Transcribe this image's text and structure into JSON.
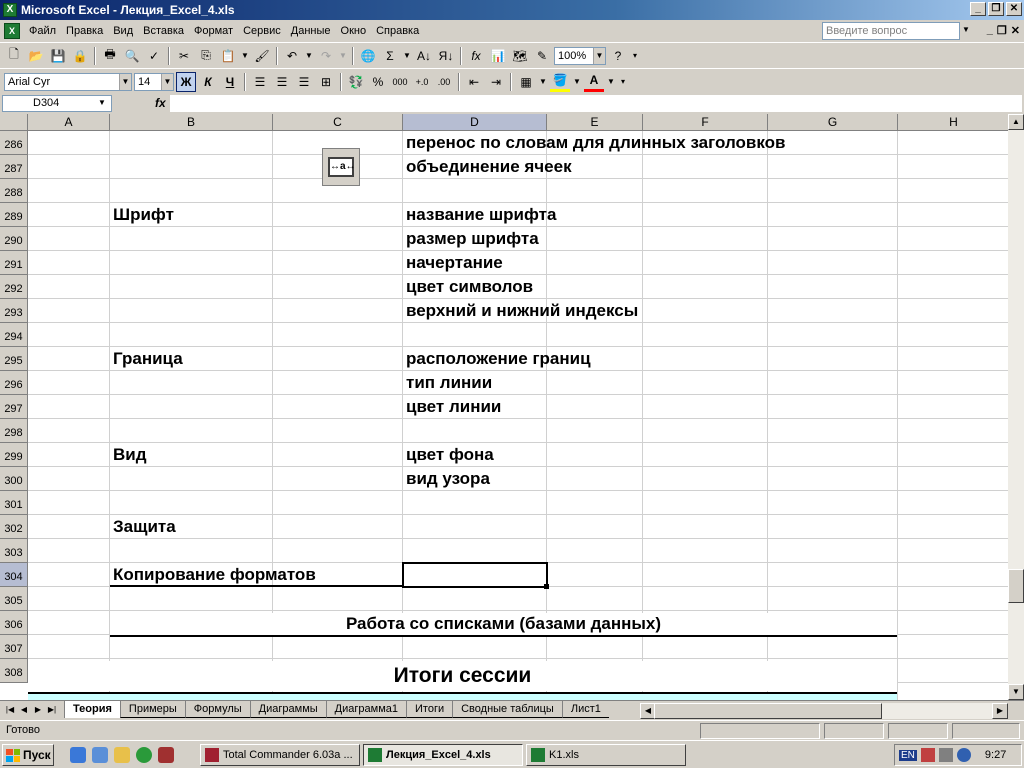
{
  "window": {
    "title": "Microsoft Excel - Лекция_Excel_4.xls",
    "controls": [
      "_",
      "❐",
      "✕"
    ]
  },
  "menu": {
    "items": [
      "Файл",
      "Правка",
      "Вид",
      "Вставка",
      "Формат",
      "Сервис",
      "Данные",
      "Окно",
      "Справка"
    ],
    "help_placeholder": "Введите вопрос"
  },
  "toolbar_standard": {
    "zoom": "100%",
    "icons": [
      "new-icon",
      "open-icon",
      "save-icon",
      "permission-icon",
      "print-icon",
      "print-preview-icon",
      "spelling-icon",
      "cut-icon",
      "copy-icon",
      "paste-icon",
      "format-painter-icon",
      "undo-icon",
      "redo-icon",
      "hyperlink-icon",
      "autosum-icon",
      "sort-asc-icon",
      "sort-desc-icon",
      "function-icon",
      "chart-wizard-icon",
      "drawing-icon",
      "help-icon"
    ]
  },
  "toolbar_format": {
    "font": "Arial Cyr",
    "size": "14",
    "bold": "Ж",
    "italic": "К",
    "underline": "Ч",
    "percent": "%",
    "thousands": "000"
  },
  "formula_bar": {
    "name_box": "D304",
    "fx": "fx",
    "content": ""
  },
  "columns": [
    "A",
    "B",
    "C",
    "D",
    "E",
    "F",
    "G",
    "H"
  ],
  "selected_column": "D",
  "rows": [
    {
      "num": "286",
      "b": "",
      "d": "перенос по словам для длинных заголовков"
    },
    {
      "num": "287",
      "b": "",
      "d": "объединение ячеек"
    },
    {
      "num": "288",
      "b": "",
      "d": ""
    },
    {
      "num": "289",
      "b": "Шрифт",
      "d": "название шрифта"
    },
    {
      "num": "290",
      "b": "",
      "d": "размер шрифта"
    },
    {
      "num": "291",
      "b": "",
      "d": "начертание"
    },
    {
      "num": "292",
      "b": "",
      "d": "цвет символов"
    },
    {
      "num": "293",
      "b": "",
      "d": "верхний и нижний индексы"
    },
    {
      "num": "294",
      "b": "",
      "d": ""
    },
    {
      "num": "295",
      "b": "Граница",
      "d": "расположение границ"
    },
    {
      "num": "296",
      "b": "",
      "d": "тип линии"
    },
    {
      "num": "297",
      "b": "",
      "d": "цвет линии"
    },
    {
      "num": "298",
      "b": "",
      "d": ""
    },
    {
      "num": "299",
      "b": "Вид",
      "d": "цвет фона"
    },
    {
      "num": "300",
      "b": "",
      "d": "вид узора"
    },
    {
      "num": "301",
      "b": "",
      "d": ""
    },
    {
      "num": "302",
      "b": "Защита",
      "d": ""
    },
    {
      "num": "303",
      "b": "",
      "d": ""
    },
    {
      "num": "304",
      "b": "Копирование форматов",
      "d": ""
    },
    {
      "num": "305",
      "b": "",
      "d": ""
    },
    {
      "num": "306",
      "b": "",
      "d": ""
    },
    {
      "num": "307",
      "b": "",
      "d": ""
    },
    {
      "num": "308",
      "b": "",
      "d": ""
    }
  ],
  "selected_row": "304",
  "merged": {
    "row306": "Работа со списками (базами данных)",
    "row308": "Итоги сессии"
  },
  "sheet_tabs": [
    "Теория",
    "Примеры",
    "Формулы",
    "Диаграммы",
    "Диаграмма1",
    "Итоги",
    "Сводные таблицы",
    "Лист1"
  ],
  "active_tab": "Теория",
  "status": {
    "text": "Готово"
  },
  "taskbar": {
    "start": "Пуск",
    "tasks": [
      {
        "label": "Total Commander 6.03a ...",
        "active": false
      },
      {
        "label": "Лекция_Excel_4.xls",
        "active": true
      },
      {
        "label": "K1.xls",
        "active": false
      }
    ],
    "lang": "EN",
    "time": "9:27"
  }
}
